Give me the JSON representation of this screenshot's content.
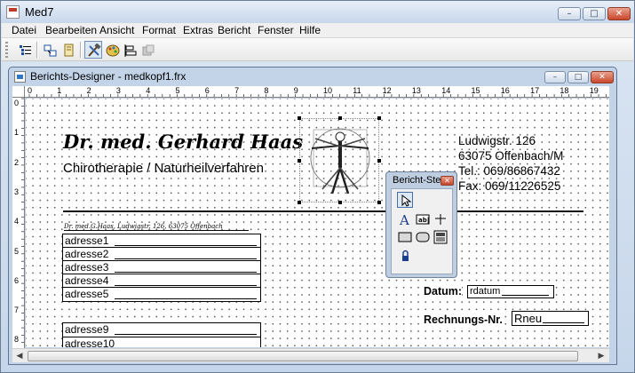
{
  "app": {
    "title": "Med7",
    "controls": {
      "minimize": "–",
      "maximize": "□",
      "close": "✕"
    }
  },
  "menu": [
    "Datei",
    "Bearbeiten",
    "Ansicht",
    "Format",
    "Extras",
    "Bericht",
    "Fenster",
    "Hilfe"
  ],
  "toolbar": {
    "buttons": [
      {
        "icon": "tree-view-icon",
        "active": false
      },
      {
        "icon": "data-environment-icon",
        "active": false
      },
      {
        "icon": "report-page-icon",
        "active": false
      },
      {
        "icon": "report-controls-toolbar-icon",
        "active": true
      },
      {
        "icon": "color-palette-icon",
        "active": false
      },
      {
        "icon": "layout-toolbar-icon",
        "active": false
      },
      {
        "icon": "print-preview-disabled-icon",
        "active": false
      }
    ]
  },
  "designer": {
    "title": "Berichts-Designer - medkopf1.frx",
    "controls": {
      "minimize": "–",
      "maximize": "□",
      "close": "✕"
    }
  },
  "ruler": {
    "horizontal": [
      "0",
      "1",
      "2",
      "3",
      "4",
      "5",
      "6",
      "7",
      "8",
      "9",
      "10",
      "11",
      "12",
      "13",
      "14",
      "15",
      "16",
      "17",
      "18",
      "19"
    ],
    "vertical": [
      "0",
      "1",
      "2",
      "3",
      "4",
      "5",
      "6",
      "7",
      "8"
    ]
  },
  "report": {
    "doctor_name": "Dr. med. Gerhard Haas",
    "specialty": "Chirotherapie / Naturheilverfahren",
    "address_lines": [
      "Ludwigstr. 126",
      "63075 Offenbach/M",
      "Tel.: 069/86867432",
      "Fax: 069/11226525"
    ],
    "sender_line": "Dr. med.G.Haas, Ludwigstr. 126, 63075 Offenbach",
    "address_fields": [
      "adresse1",
      "adresse2",
      "adresse3",
      "adresse4",
      "adresse5"
    ],
    "address_fields_2": [
      "adresse9",
      "adresse10"
    ],
    "date_label": "Datum:",
    "date_field": "rdatum",
    "invoice_label": "Rechnungs-Nr.",
    "invoice_field": "Rneu"
  },
  "toolbox": {
    "title": "Bericht-Ste",
    "close": "✕",
    "tools": [
      "pointer-icon",
      "label-icon",
      "field-icon",
      "line-icon",
      "rectangle-icon",
      "rounded-rectangle-icon",
      "picture-icon",
      "button-lock-icon"
    ]
  },
  "scrollbar": {
    "left": "◀",
    "right": "▶"
  }
}
